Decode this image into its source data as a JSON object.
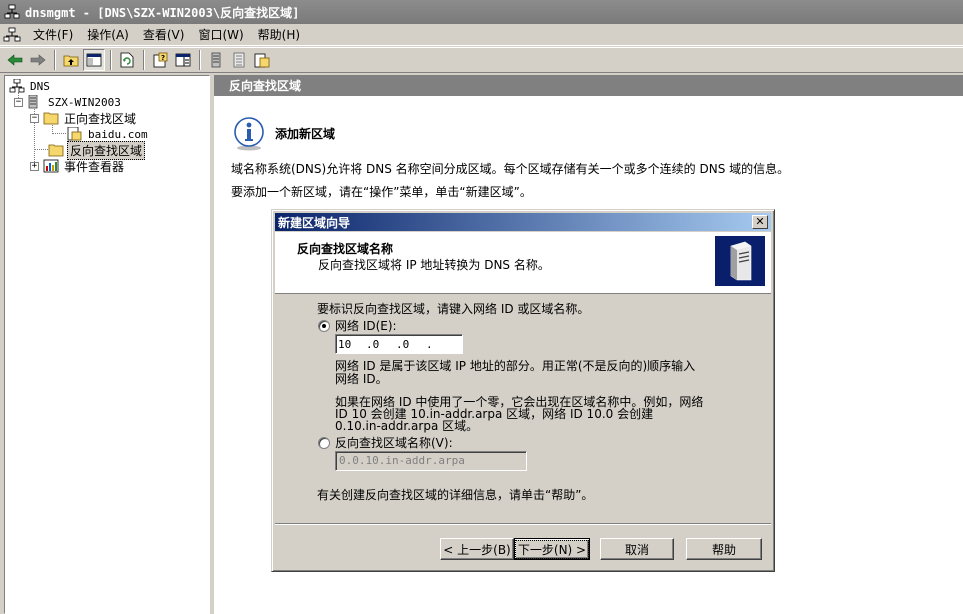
{
  "window": {
    "title": "dnsmgmt - [DNS\\SZX-WIN2003\\反向查找区域]"
  },
  "menu": [
    "文件(F)",
    "操作(A)",
    "查看(V)",
    "窗口(W)",
    "帮助(H)"
  ],
  "tree": {
    "root": "DNS",
    "server": "SZX-WIN2003",
    "forward_zone": "正向查找区域",
    "forward_child": "baidu.com",
    "reverse_zone": "反向查找区域",
    "event_viewer": "事件查看器"
  },
  "right_pane": {
    "header": "反向查找区域",
    "info_title": "添加新区域",
    "desc_line1": "域名称系统(DNS)允许将 DNS 名称空间分成区域。每个区域存储有关一个或多个连续的 DNS 域的信息。",
    "desc_line2": "要添加一个新区域，请在“操作”菜单，单击“新建区域”。"
  },
  "dialog": {
    "title": "新建区域向导",
    "header_title": "反向查找区域名称",
    "header_subtitle": "反向查找区域将 IP 地址转换为 DNS 名称。",
    "prompt": "要标识反向查找区域，请键入网络 ID 或区域名称。",
    "network_id_label": "网络 ID(E):",
    "ip_octets": [
      "10",
      ".0",
      ".0",
      "."
    ],
    "network_id_help_1": "网络 ID 是属于该区域 IP 地址的部分。用正常(不是反向的)顺序输入",
    "network_id_help_2": "网络 ID。",
    "zero_help_1": "如果在网络 ID 中使用了一个零，它会出现在区域名称中。例如，网络",
    "zero_help_2": "ID 10 会创建 10.in-addr.arpa 区域，网络 ID 10.0 会创建",
    "zero_help_3": "0.10.in-addr.arpa 区域。",
    "reverse_name_label": "反向查找区域名称(V):",
    "reverse_name_value": "0.0.10.in-addr.arpa",
    "more_info": "有关创建反向查找区域的详细信息，请单击“帮助”。",
    "network_id_selected": true,
    "buttons": {
      "back": "< 上一步(B)",
      "next": "下一步(N) >",
      "cancel": "取消",
      "help": "帮助"
    }
  }
}
